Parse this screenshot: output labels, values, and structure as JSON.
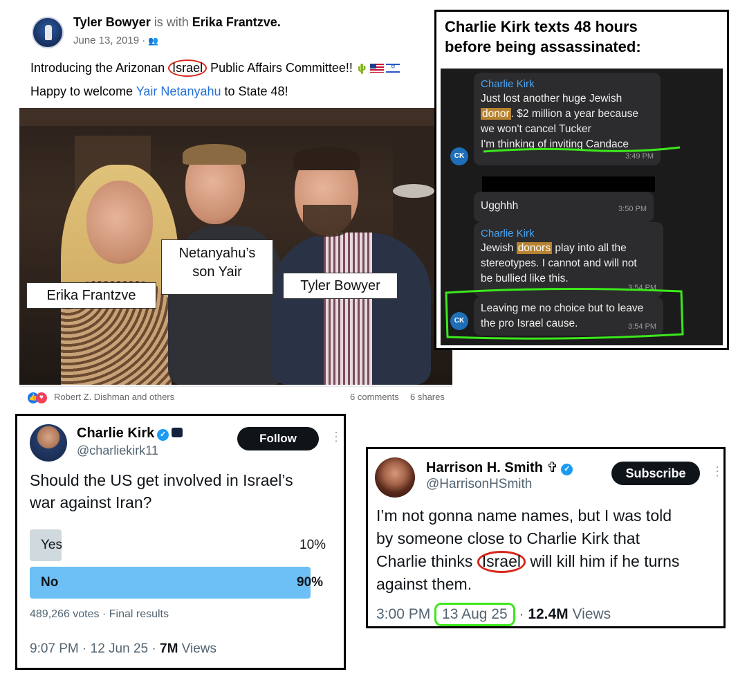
{
  "facebook_post": {
    "author": "Tyler Bowyer",
    "with_text": "is with",
    "tagged": "Erika Frantzve.",
    "date": "June 13, 2019 ·",
    "audience_icon": "friends-icon",
    "line1_before": "Introducing the Arizonan ",
    "line1_circled": "Israel",
    "line1_after": " Public Affairs Committee!!",
    "line2_before": "Happy to welcome ",
    "line2_link": "Yair Netanyahu",
    "line2_after": " to State 48!",
    "photo_labels": {
      "yair_line1": "Netanyahu’s",
      "yair_line2": "son Yair",
      "erika": "Erika Frantzve",
      "tyler": "Tyler Bowyer"
    },
    "reactions_text": "Robert Z. Dishman and others",
    "comments": "6 comments",
    "shares": "6 shares"
  },
  "chat": {
    "title_line1": "Charlie Kirk texts 48 hours",
    "title_line2": "before being assassinated:",
    "avatar_initials": "CK",
    "messages": [
      {
        "sender": "Charlie Kirk",
        "line1": "Just lost another huge Jewish",
        "hl": "donor",
        "line2_after": ". $2 million a year because",
        "line3": "we won't cancel Tucker",
        "line4": "I'm thinking of inviting Candace",
        "time": "3:49 PM"
      },
      {
        "text": "Ugghhh",
        "time": "3:50 PM"
      },
      {
        "sender": "Charlie Kirk",
        "line1_before": "Jewish ",
        "hl": "donors",
        "line1_after": " play into all the",
        "line2": "stereotypes. I cannot and will not",
        "line3": "be bullied like this.",
        "time": "3:54 PM"
      },
      {
        "line1": "Leaving me no choice but to leave",
        "line2": "the pro Israel cause.",
        "time": "3:54 PM"
      }
    ]
  },
  "poll_tweet": {
    "name": "Charlie Kirk",
    "handle": "@charliekirk11",
    "follow_label": "Follow",
    "question_line1": "Should the US get involved in Israel’s",
    "question_line2": "war against Iran?",
    "options": [
      {
        "label": "Yes",
        "pct_text": "10%",
        "pct": 10
      },
      {
        "label": "No",
        "pct_text": "90%",
        "pct": 90
      }
    ],
    "votes": "489,266 votes · Final results",
    "time_prefix": "9:07 PM · 12 Jun 25 · ",
    "views_num": "7M",
    "views_word": " Views"
  },
  "harrison_tweet": {
    "name": "Harrison H. Smith",
    "cross_glyph": "✞",
    "handle": "@HarrisonHSmith",
    "subscribe_label": "Subscribe",
    "text_line1": "I’m not gonna name names, but I was told",
    "text_line2": "by someone close to Charlie Kirk that",
    "text_line3_before": "Charlie thinks ",
    "text_line3_circled": "Israel",
    "text_line3_after": " will kill him if he turns",
    "text_line4": "against them.",
    "time": "3:00 PM ",
    "date_circled": "13 Aug 25",
    "sep": " · ",
    "views_num": "12.4M",
    "views_word": " Views"
  },
  "colors": {
    "twitter_blue": "#1d9bf0",
    "poll_winner": "#6cc0f5",
    "poll_other": "#cfd9de",
    "annotation_red": "#d9261c",
    "annotation_green": "#3ce81b",
    "highlight_orange": "#b88230"
  }
}
